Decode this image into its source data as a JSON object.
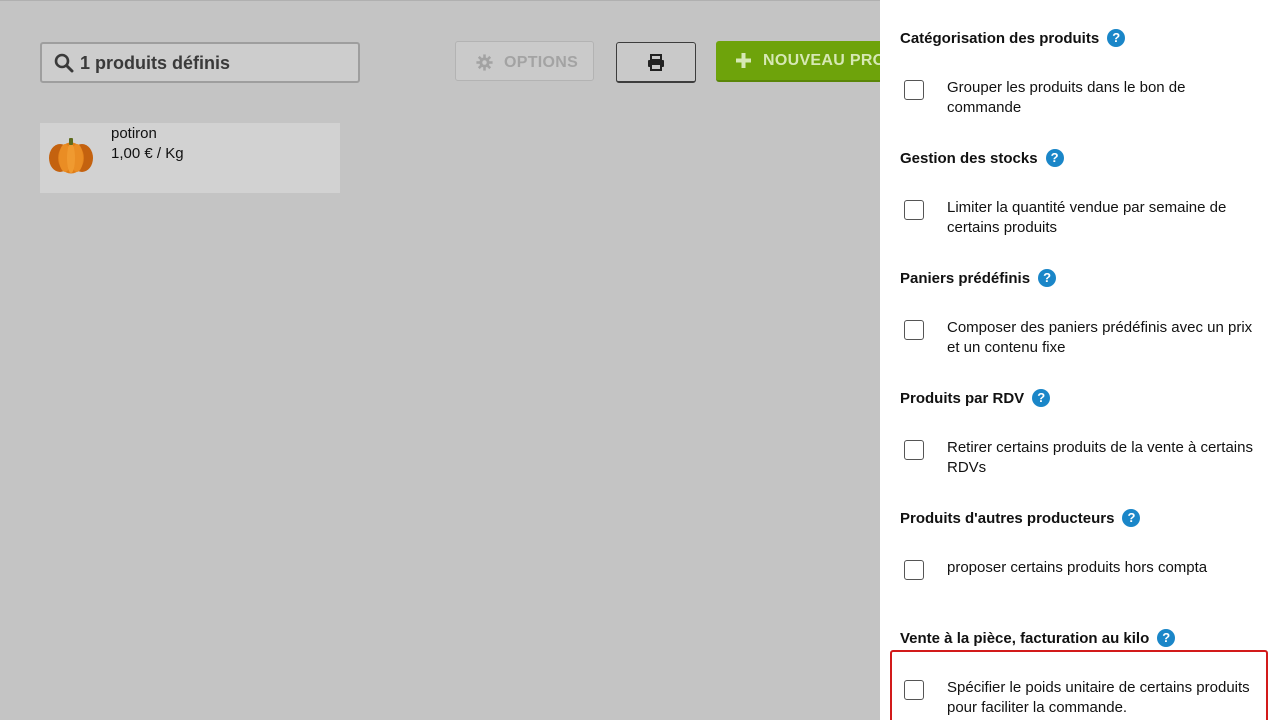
{
  "toolbar": {
    "search_text": "1 produits définis",
    "options_label": "OPTIONS",
    "new_product_label": "NOUVEAU PRODUIT",
    "accent_color": "#6ea30b"
  },
  "products": [
    {
      "name": "potiron",
      "price": "1,00 € / Kg",
      "icon": "pumpkin-image"
    }
  ],
  "panel": {
    "sections": [
      {
        "title": "Catégorisation des produits",
        "option": "Grouper les produits dans le bon de commande",
        "checked": false
      },
      {
        "title": "Gestion des stocks",
        "option": "Limiter la quantité vendue par semaine de certains produits",
        "checked": false
      },
      {
        "title": "Paniers prédéfinis",
        "option": "Composer des paniers prédéfinis avec un prix et un contenu fixe",
        "checked": false
      },
      {
        "title": "Produits par RDV",
        "option": "Retirer certains produits de la vente à certains RDVs",
        "checked": false
      },
      {
        "title": "Produits d'autres producteurs",
        "option": "proposer certains produits hors compta",
        "checked": false
      },
      {
        "title": "Vente à la pièce, facturation au kilo",
        "option": "Spécifier le poids unitaire de certains produits pour faciliter la commande.",
        "checked": false
      }
    ],
    "help_glyph": "?",
    "help_color": "#1a86c8",
    "highlight_color": "#d21a1a"
  }
}
